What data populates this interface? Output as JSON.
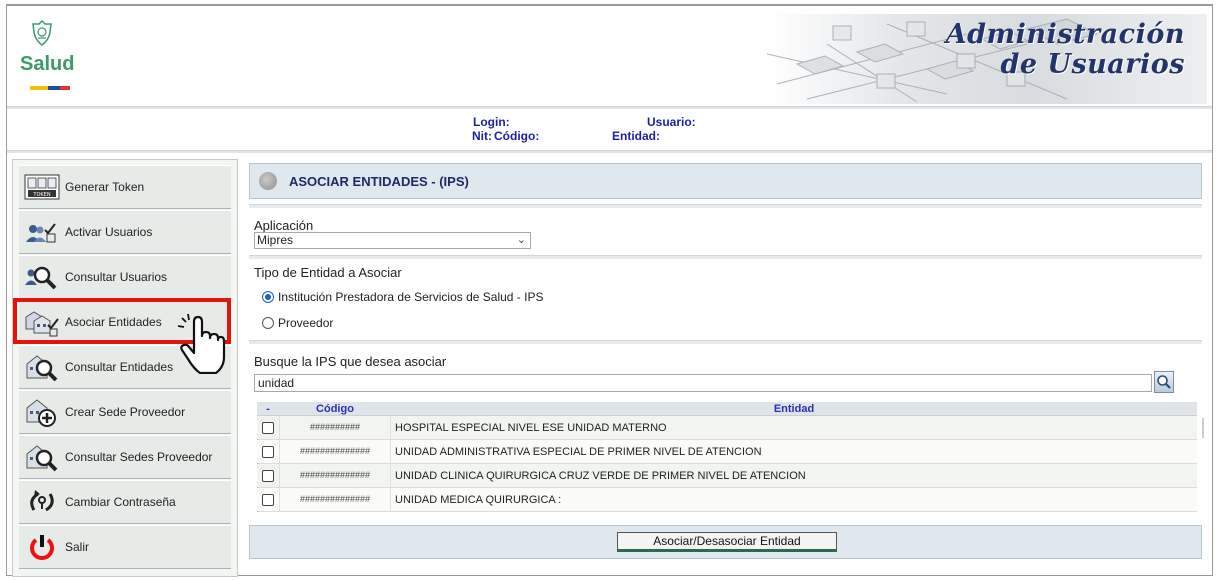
{
  "header": {
    "logo_text": "Salud",
    "title_line1": "Administración",
    "title_line2": "de Usuarios"
  },
  "info": {
    "login_label": "Login:",
    "usuario_label": "Usuario:",
    "nit_label": "Nit:",
    "codigo_label": "Código:",
    "entidad_label": "Entidad:"
  },
  "sidebar": {
    "items": [
      {
        "label": "Generar Token",
        "icon": "token-icon"
      },
      {
        "label": "Activar Usuarios",
        "icon": "users-activate-icon"
      },
      {
        "label": "Consultar Usuarios",
        "icon": "users-search-icon"
      },
      {
        "label": "Asociar Entidades",
        "icon": "associate-entities-icon"
      },
      {
        "label": "Consultar Entidades",
        "icon": "entities-search-icon"
      },
      {
        "label": "Crear Sede Proveedor",
        "icon": "add-site-icon"
      },
      {
        "label": "Consultar Sedes Proveedor",
        "icon": "sites-search-icon"
      },
      {
        "label": "Cambiar Contraseña",
        "icon": "change-password-icon"
      },
      {
        "label": "Salir",
        "icon": "power-icon"
      }
    ]
  },
  "main": {
    "panel_title": "ASOCIAR ENTIDADES - (IPS)",
    "app_label": "Aplicación",
    "app_value": "Mipres",
    "type_label": "Tipo de Entidad a Asociar",
    "radio_ips": "Institución Prestadora de Servicios de Salud - IPS",
    "radio_proveedor": "Proveedor",
    "search_label": "Busque la IPS que desea asociar",
    "search_value": "unidad",
    "grid": {
      "col_check": "-",
      "col_code": "Código",
      "col_entity": "Entidad",
      "rows": [
        {
          "code": "##########",
          "entity": "HOSPITAL  ESPECIAL  NIVEL ESE UNIDAD MATERNO"
        },
        {
          "code": "##############",
          "entity": " UNIDAD ADMINISTRATIVA ESPECIAL DE PRIMER NIVEL DE ATENCION"
        },
        {
          "code": "##############",
          "entity": "UNIDAD CLINICA QUIRURGICA CRUZ VERDE DE PRIMER NIVEL DE ATENCION"
        },
        {
          "code": "##############",
          "entity": "UNIDAD MEDICA QUIRURGICA :"
        }
      ]
    },
    "submit_label": "Asociar/Desasociar Entidad"
  },
  "colors": {
    "highlight": "#e3140e",
    "label_blue": "#1b1fa8",
    "title_navy": "#23346b"
  }
}
